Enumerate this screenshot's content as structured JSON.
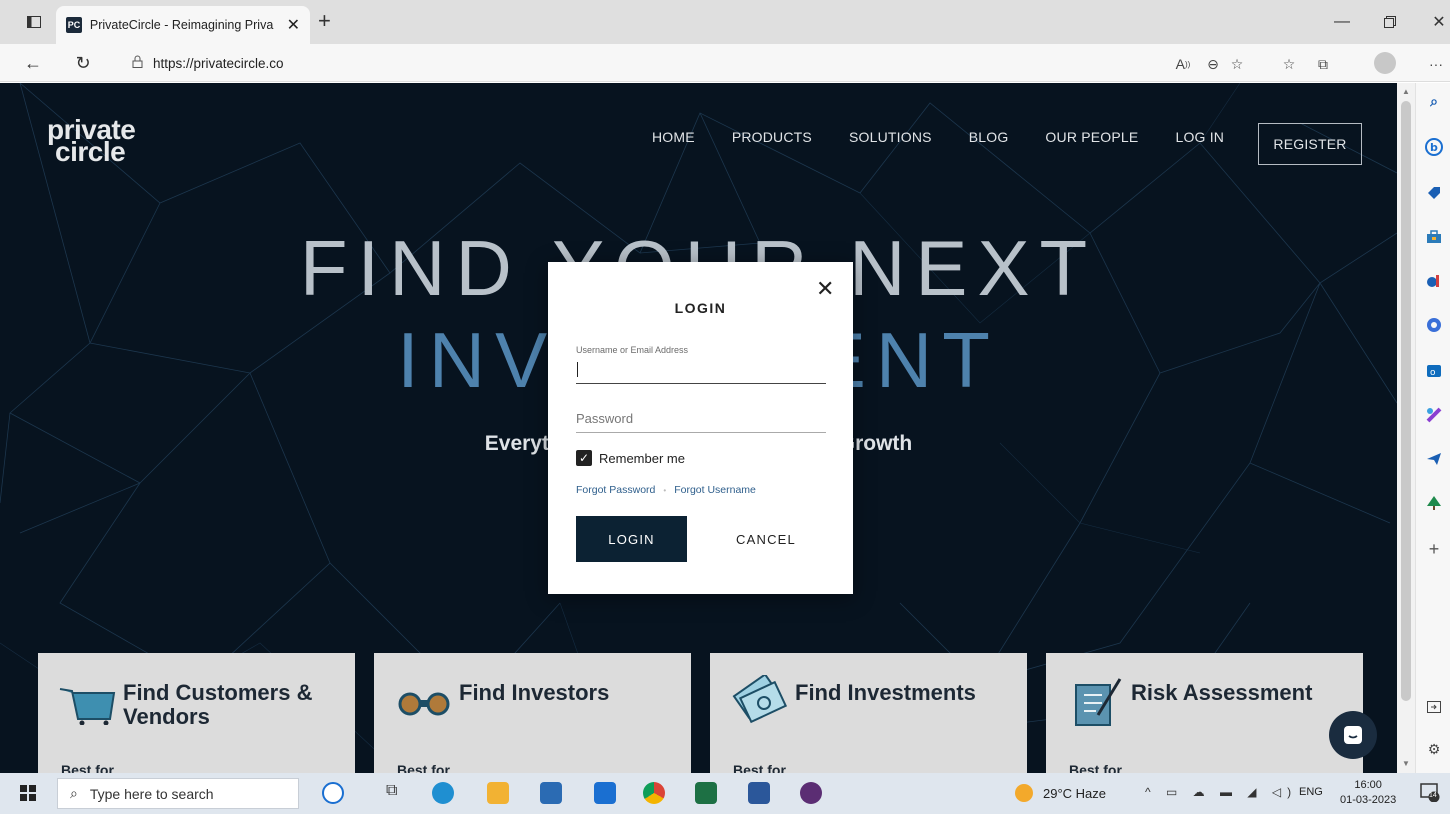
{
  "browser": {
    "tab_title": "PrivateCircle - Reimagining Priva",
    "favicon_text": "PC",
    "url": "https://privatecircle.co"
  },
  "site": {
    "logo": [
      "private",
      "circle"
    ],
    "nav": [
      "HOME",
      "PRODUCTS",
      "SOLUTIONS",
      "BLOG",
      "OUR PEOPLE",
      "LOG IN"
    ],
    "register_label": "REGISTER",
    "hero_line1": "FIND YOUR NEXT",
    "hero_line2": "INVESTMENT",
    "hero_sub": "Everything You Need For Business Growth",
    "cards": [
      {
        "title": "Find Customers & Vendors",
        "best": "Best for",
        "icon": "cart-icon"
      },
      {
        "title": "Find Investors",
        "best": "Best for",
        "icon": "binoculars-icon"
      },
      {
        "title": "Find Investments",
        "best": "Best for",
        "icon": "money-icon"
      },
      {
        "title": "Risk Assessment",
        "best": "Best for",
        "icon": "document-pen-icon"
      }
    ]
  },
  "login_modal": {
    "title": "LOGIN",
    "username_label": "Username or Email Address",
    "username_value": "",
    "password_placeholder": "Password",
    "remember_label": "Remember me",
    "remember_checked": true,
    "forgot_password": "Forgot Password",
    "forgot_sep": "•",
    "forgot_username": "Forgot Username",
    "login_button": "LOGIN",
    "cancel_button": "CANCEL"
  },
  "taskbar": {
    "search_placeholder": "Type here to search",
    "weather": "29°C  Haze",
    "lang": "ENG",
    "time": "16:00",
    "date": "01-03-2023",
    "notifications": "14"
  },
  "colors": {
    "hero_bg": "#07131f",
    "accent_blue": "#4e82ad",
    "modal_button": "#0c2233",
    "link_blue": "#2f5f8c"
  }
}
